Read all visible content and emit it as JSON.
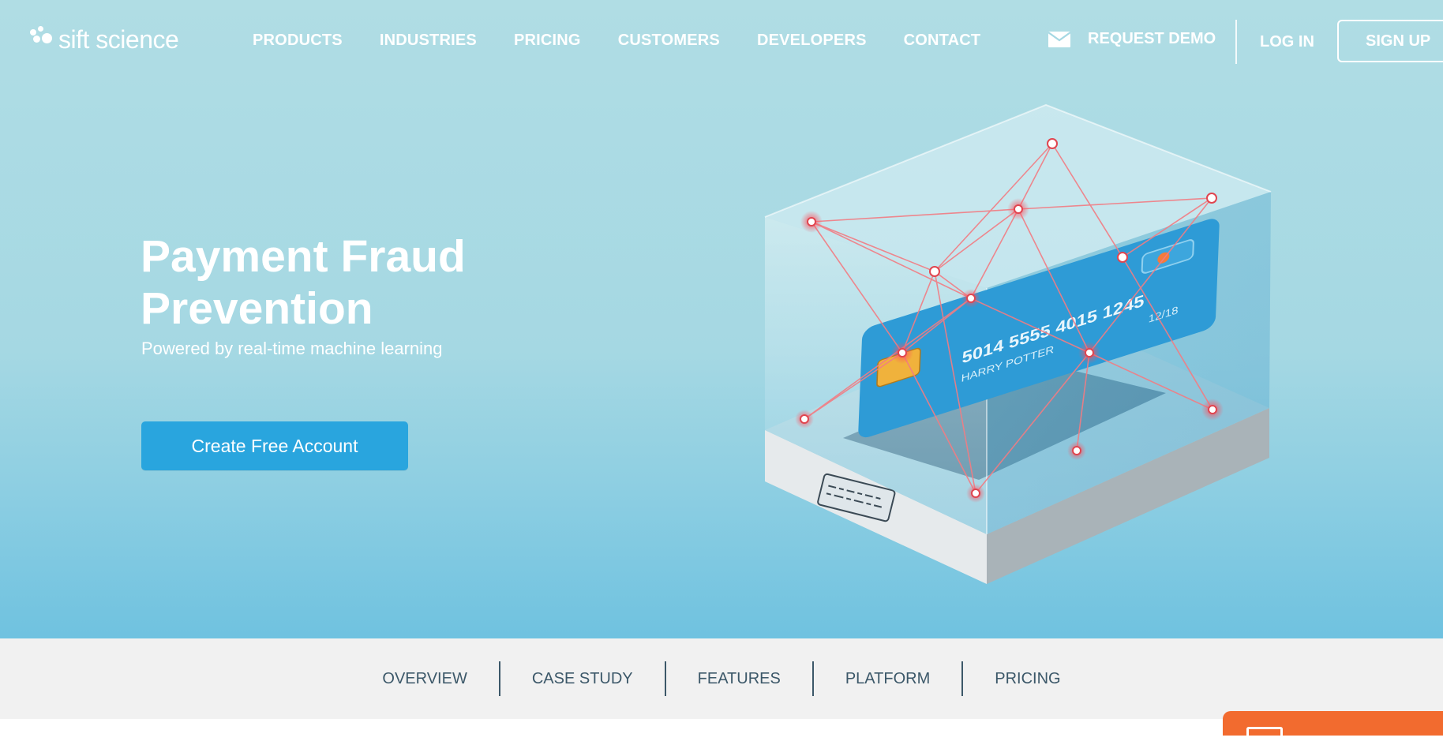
{
  "brand": {
    "name": "sift science",
    "logo_icon": "hexagon-cluster-icon"
  },
  "nav": {
    "items": [
      "PRODUCTS",
      "INDUSTRIES",
      "PRICING",
      "CUSTOMERS",
      "DEVELOPERS",
      "CONTACT"
    ],
    "request_demo": "REQUEST DEMO",
    "request_demo_icon": "envelope-icon",
    "login": "LOG IN",
    "signup": "SIGN UP"
  },
  "hero": {
    "title_line1": "Payment Fraud",
    "title_line2": "Prevention",
    "subtitle": "Powered by real-time machine learning",
    "cta": "Create Free Account",
    "illustration": {
      "card_number_line1": "5014  5555  4015  1245",
      "card_holder": "HARRY POTTER",
      "card_expiry": "12/18"
    }
  },
  "subnav": {
    "items": [
      "OVERVIEW",
      "CASE STUDY",
      "FEATURES",
      "PLATFORM",
      "PRICING"
    ]
  },
  "chat_tab": {
    "icon": "envelope-icon"
  },
  "colors": {
    "hero_top": "#b0dde4",
    "hero_bottom": "#6fc2e0",
    "cta": "#29a5de",
    "subnav_bg": "#f1f1f1",
    "subnav_text": "#3c5869",
    "chat_tab": "#f26b2f",
    "network_nodes": "#e0454f"
  }
}
